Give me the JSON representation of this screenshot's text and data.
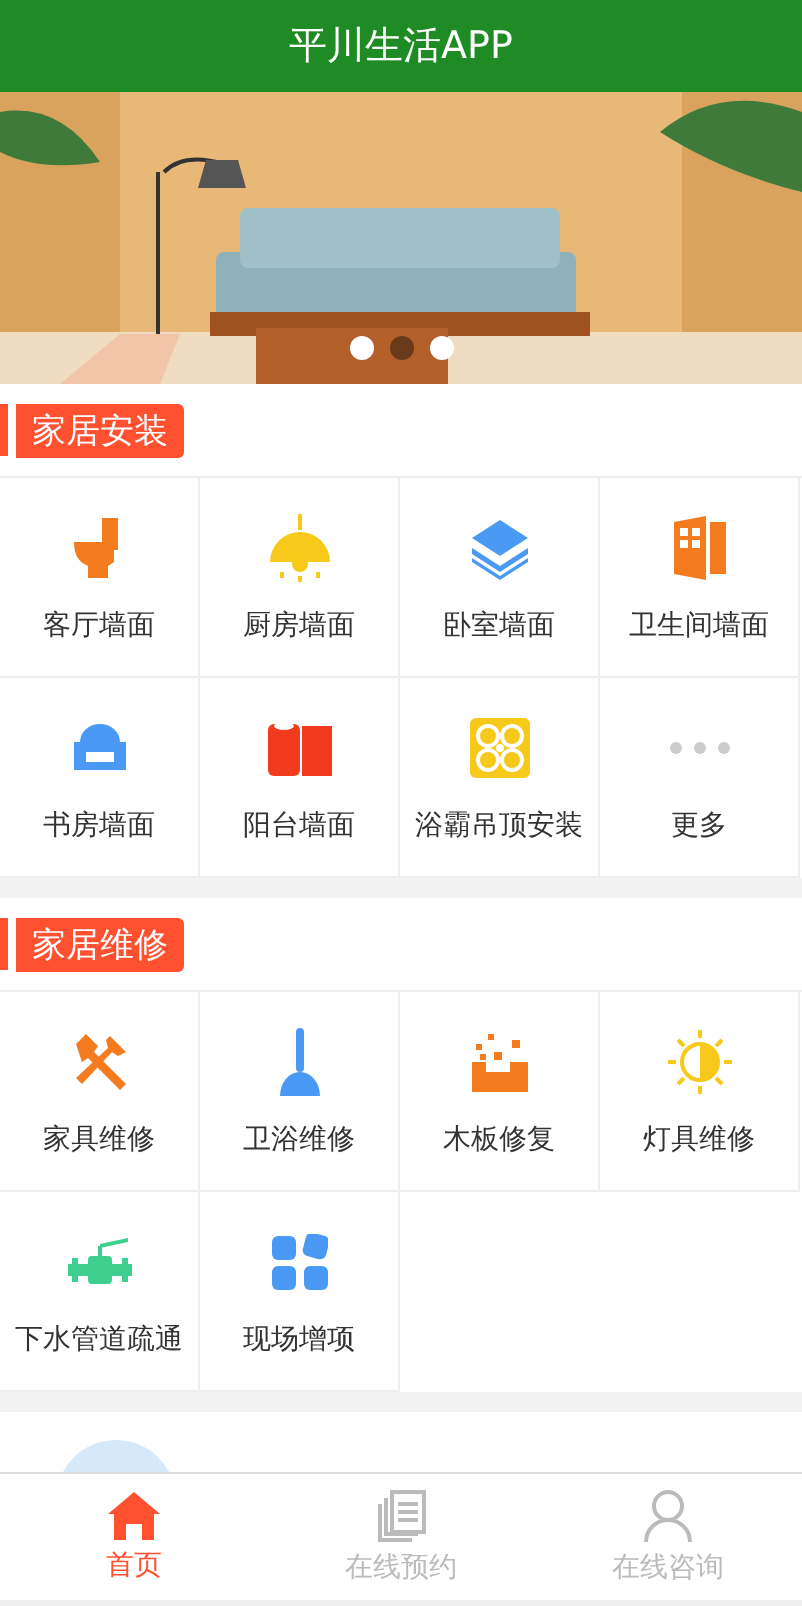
{
  "header": {
    "title": "平川生活APP"
  },
  "banner": {
    "kind": "picture",
    "dots": [
      {
        "selected": false
      },
      {
        "selected": true
      },
      {
        "selected": false
      }
    ]
  },
  "sections": [
    {
      "title": "家居安装",
      "items": [
        {
          "label": "客厅墙面"
        },
        {
          "label": "厨房墙面"
        },
        {
          "label": "卧室墙面"
        },
        {
          "label": "卫生间墙面"
        },
        {
          "label": "书房墙面"
        },
        {
          "label": "阳台墙面"
        },
        {
          "label": "浴霸吊顶安装"
        },
        {
          "label": "更多"
        }
      ]
    },
    {
      "title": "家居维修",
      "items": [
        {
          "label": "家具维修"
        },
        {
          "label": "卫浴维修"
        },
        {
          "label": "木板修复"
        },
        {
          "label": "灯具维修"
        },
        {
          "label": "下水管道疏通"
        },
        {
          "label": "现场增项"
        }
      ]
    }
  ],
  "tab_bar": [
    {
      "label": "首页",
      "selected": true
    },
    {
      "label": "在线预约",
      "selected": false
    },
    {
      "label": "在线咨询",
      "selected": false
    }
  ]
}
